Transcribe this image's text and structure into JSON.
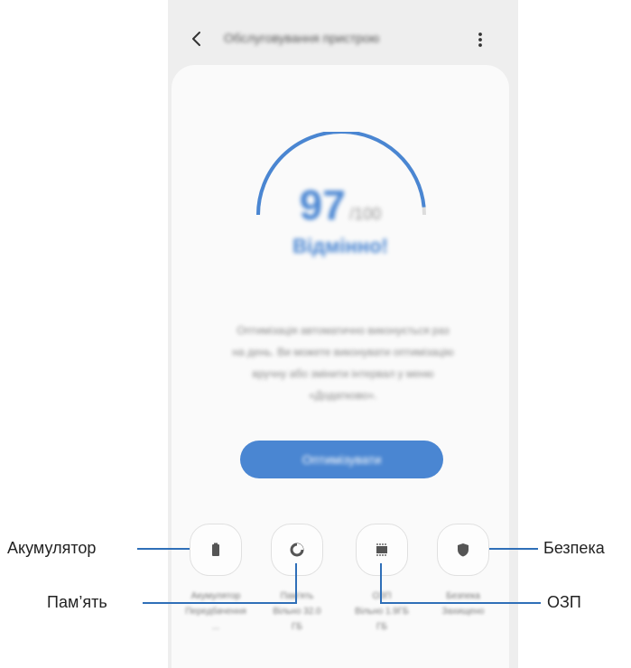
{
  "appbar": {
    "title": "Обслуговування пристрою",
    "back_icon": "chevron-left-icon",
    "more_icon": "more-vertical-icon"
  },
  "score": {
    "value": "97",
    "max": "/100",
    "level": 0.97,
    "status": "Відмінно!"
  },
  "description": {
    "lines": [
      "Оптимізація автоматично виконується раз",
      "на день. Ви можете виконувати оптимізацію",
      "вручну або змінити інтервал у меню",
      "«Додатково»."
    ]
  },
  "optimize_button": {
    "label": "Оптимізувати"
  },
  "tiles": [
    {
      "icon": "battery-icon",
      "label_lines": [
        "Акумулятор",
        "Передбачення",
        "..."
      ]
    },
    {
      "icon": "storage-pie-icon",
      "label_lines": [
        "Пам'ять",
        "Вільно 32.0",
        "ГБ"
      ]
    },
    {
      "icon": "memory-chip-icon",
      "label_lines": [
        "ОЗП",
        "Вільно 1.9ГБ",
        "ГБ"
      ]
    },
    {
      "icon": "shield-icon",
      "label_lines": [
        "Безпека",
        "Захищено",
        ""
      ]
    }
  ],
  "callouts": {
    "battery": "Акумулятор",
    "storage": "Пам’ять",
    "security": "Безпека",
    "memory": "ОЗП"
  },
  "colors": {
    "accent": "#4a86d2",
    "callout_line": "#2f6fb8",
    "screen_bg": "#eeeeee",
    "card_bg": "#fafafa"
  }
}
